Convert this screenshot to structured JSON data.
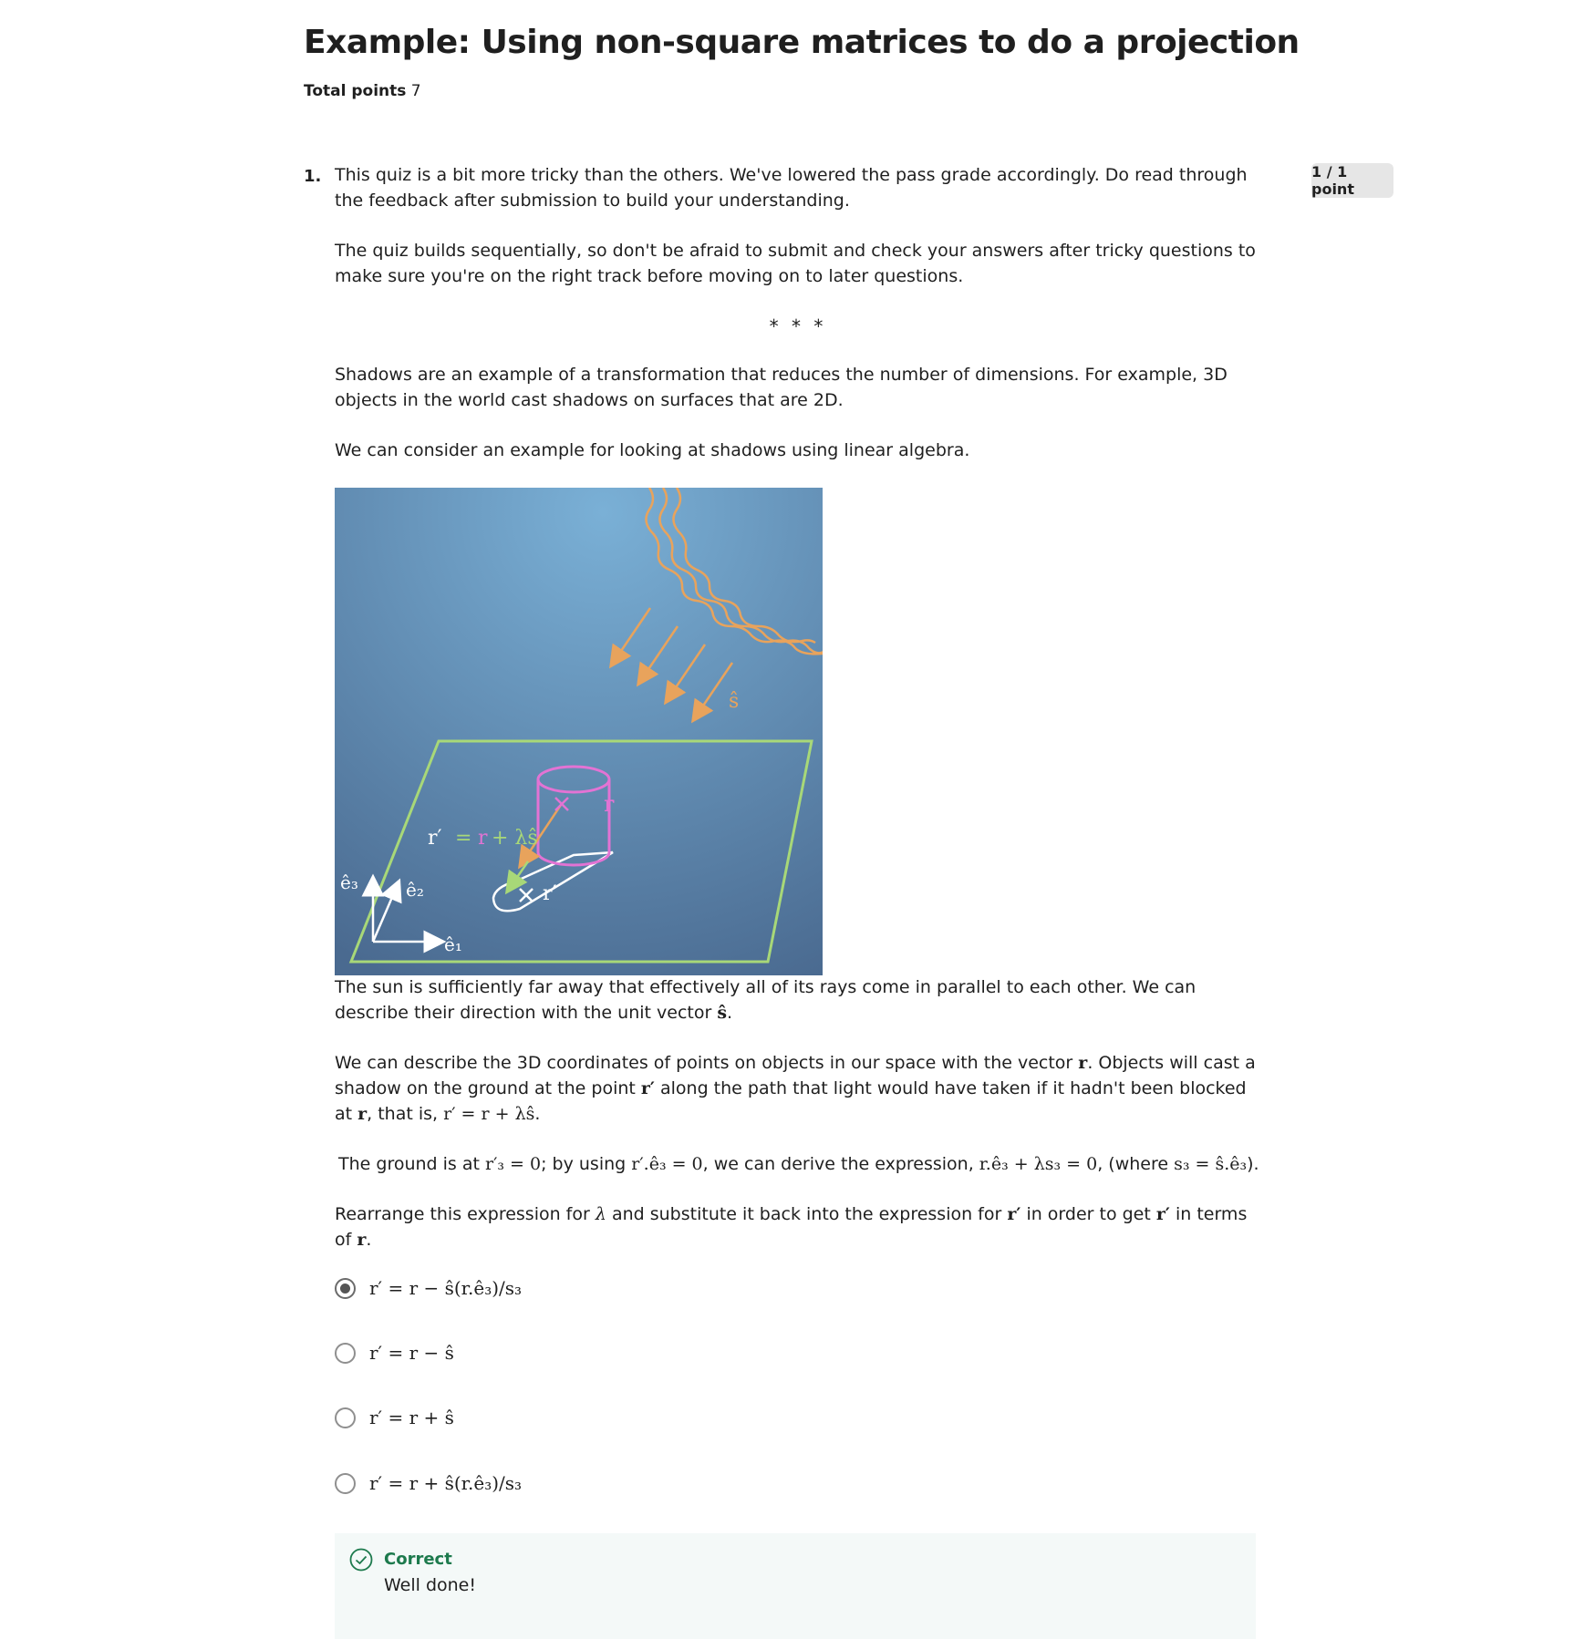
{
  "header": {
    "title": "Example: Using non-square matrices to do a projection",
    "total_label": "Total points",
    "total_value": "7"
  },
  "question": {
    "number": "1.",
    "score": "1 / 1 point",
    "intro_1": "This quiz is a bit more tricky than the others. We've lowered the pass grade accordingly. Do read through the feedback after submission to build your understanding.",
    "intro_2": "The quiz builds sequentially, so don't be afraid to submit and check your answers after tricky questions to make sure you're on the right track before moving on to later questions.",
    "separator": "* * *",
    "shadow_1": "Shadows are an example of a transformation that reduces the number of dimensions. For example, 3D objects in the world cast shadows on surfaces that are 2D.",
    "shadow_2": "We can consider an example for looking at shadows using linear algebra.",
    "sun_text": "The sun is sufficiently far away that effectively all of its rays come in parallel to each other. We can describe their direction with the unit vector",
    "sun_vec": "ŝ",
    "coords_a": "We can describe the 3D coordinates of points on objects in our space with the vector",
    "coords_r": "r",
    "coords_b": ". Objects will cast a shadow on the ground at the point",
    "coords_rp": "r′",
    "coords_c": "along the path that light would have taken if it hadn't been blocked at",
    "coords_d": ", that is,",
    "coords_eq": "r′ = r + λŝ",
    "ground_a": "The ground is at",
    "ground_eq1": "r′₃ = 0",
    "ground_b": "; by using",
    "ground_eq2": "r′.ê₃ = 0",
    "ground_c": ", we can derive the expression,",
    "ground_eq3": "r.ê₃ + λs₃ = 0",
    "ground_d": ", (where",
    "ground_eq4": "s₃ = ŝ.ê₃",
    "ground_e": ").",
    "rearr_a": "Rearrange this expression for",
    "rearr_lambda": "λ",
    "rearr_b": "and substitute it back into the expression for",
    "rearr_c": "in order to get",
    "rearr_d": "in terms of",
    "options": [
      {
        "label": "r′ = r − ŝ(r.ê₃)/s₃",
        "selected": true
      },
      {
        "label": "r′ = r − ŝ",
        "selected": false
      },
      {
        "label": "r′ = r + ŝ",
        "selected": false
      },
      {
        "label": "r′ = r + ŝ(r.ê₃)/s₃",
        "selected": false
      }
    ],
    "feedback": {
      "status": "Correct",
      "message": "Well done!"
    }
  },
  "figure": {
    "label_s": "ŝ",
    "label_r": "r",
    "label_rp": "r′",
    "label_eq_rp": "r′",
    "label_eq_eq": "=",
    "label_eq_r": "r",
    "label_eq_rest": "+ λŝ",
    "label_e1": "ê₁",
    "label_e2": "ê₂",
    "label_e3": "ê₃",
    "colors": {
      "sky_top": "#7ab0d6",
      "sky_bottom": "#4a6a90",
      "rays": "#e8a35c",
      "plane": "#a8d878",
      "cylinder": "#e373d4",
      "shadow": "#ffffff"
    }
  },
  "colors": {
    "correct": "#1d7a4d",
    "feedback_bg": "#f4f9f8",
    "badge_bg": "#e6e6e6"
  }
}
